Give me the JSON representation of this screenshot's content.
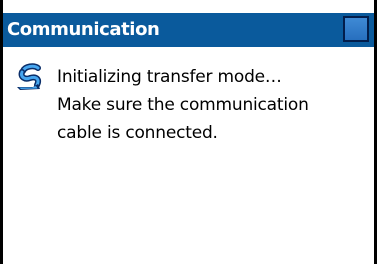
{
  "window": {
    "title": "Communication"
  },
  "message": {
    "lines": [
      "Initializing transfer mode…",
      "Make sure the communication",
      "cable is connected."
    ]
  },
  "icons": {
    "title_button": "minimize-square-icon",
    "message_icon": "cable-connection-icon"
  },
  "colors": {
    "titlebar": "#0a5a9c",
    "title_text": "#ffffff",
    "title_button": "#3f8ad5",
    "border": "#000000",
    "background": "#ffffff"
  }
}
